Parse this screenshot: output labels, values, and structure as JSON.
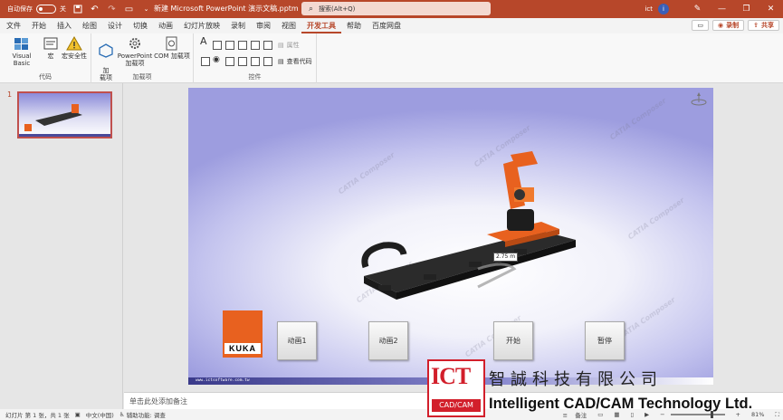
{
  "titlebar": {
    "autosave_label": "自动保存",
    "autosave_state": "关",
    "doc_title": "新建 Microsoft PowerPoint 演示文稿.pptm ⌄",
    "search_placeholder": "搜索(Alt+Q)",
    "user": "ict",
    "user_initial": "i"
  },
  "tabs": {
    "items": [
      "文件",
      "开始",
      "插入",
      "绘图",
      "设计",
      "切换",
      "动画",
      "幻灯片放映",
      "录制",
      "审阅",
      "视图",
      "开发工具",
      "帮助",
      "百度网盘"
    ],
    "active": "开发工具",
    "comment_label": "",
    "record_label": "录制",
    "share_label": "共享"
  },
  "ribbon": {
    "code_group": "代码",
    "visual_basic": "Visual Basic",
    "macro": "宏",
    "macro_security": "宏安全性",
    "addins_group": "加载项",
    "addin": "加\n载项",
    "ppt_addin_1": "PowerPoint",
    "ppt_addin_2": "加载项",
    "com_addin": "COM 加载项",
    "controls_group": "控件",
    "properties": "属性",
    "view_code": "查看代码"
  },
  "thumbs": {
    "slide_number": "1"
  },
  "slide": {
    "measure_label": "2.75 m",
    "kuka_text": "KUKA",
    "footer_url": "www.ictsoftware.com.tw",
    "buttons": {
      "anim1": "动画1",
      "anim2": "动画2",
      "start": "开始",
      "pause": "暂停"
    },
    "watermark_text": "CATIA Composer"
  },
  "notes": {
    "placeholder": "单击此处添加备注"
  },
  "status": {
    "slide_info": "幻灯片 第 1 张，共 1 张",
    "language": "中文(中国)",
    "accessibility": "辅助功能: 调查",
    "notes_label": "备注",
    "zoom": "81%"
  },
  "logo": {
    "letters": "ICT",
    "cadcam": "CAD/CAM",
    "chinese_name": "智誠科技有限公司",
    "english_name": "Intelligent CAD/CAM Technology Ltd."
  },
  "colors": {
    "accent": "#b7472a",
    "kuka_orange": "#e8611f",
    "ict_red": "#d21f2b"
  }
}
